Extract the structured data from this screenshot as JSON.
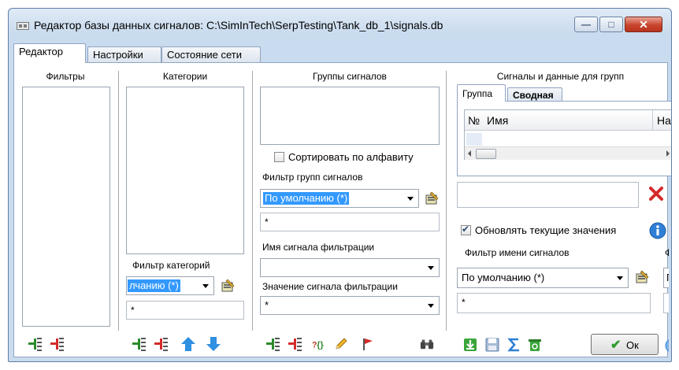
{
  "window": {
    "title": "Редактор базы данных сигналов: C:\\SimInTech\\SerpTesting\\Tank_db_1\\signals.db",
    "minimize_glyph": "—",
    "maximize_glyph": "□",
    "close_glyph": "✕"
  },
  "tabs": [
    "Редактор",
    "Настройки",
    "Состояние сети"
  ],
  "filters": {
    "header": "Фильтры"
  },
  "categories": {
    "header": "Категории",
    "filter_label": "Фильтр категорий",
    "filter_value": "лчанию (*)",
    "text_value": "*"
  },
  "groups": {
    "header": "Группы сигналов",
    "sort_label": "Сортировать по алфавиту",
    "sort_checked": false,
    "group_filter_label": "Фильтр групп сигналов",
    "group_filter_value": "По умолчанию (*)",
    "group_filter_text": "*",
    "signal_name_label": "Имя сигнала фильтрации",
    "signal_name_value": "",
    "signal_value_label": "Значение сигнала фильтрации",
    "signal_value_value": "*"
  },
  "signals": {
    "header": "Сигналы и данные для групп",
    "subtabs": [
      "Группа",
      "Сводная"
    ],
    "columns": [
      "№",
      "Имя",
      "На"
    ],
    "update_label": "Обновлять текущие значения",
    "update_checked": true,
    "name_filter_label": "Фильтр имени сигналов",
    "name_filter_value": "По умолчанию (*)",
    "name_filter_text": "*",
    "cut_label": "Ф",
    "cut_combo_value": "Г",
    "ok_label": "Ок"
  },
  "colors": {
    "accent": "#3399ff",
    "close": "#c9442d",
    "add": "#2c8a2c",
    "remove": "#d42a2a",
    "arrow": "#2f8fe0"
  }
}
